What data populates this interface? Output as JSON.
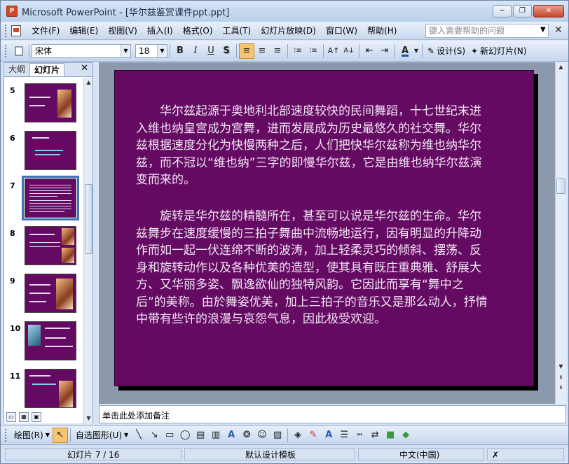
{
  "titlebar": {
    "icon_label": "P",
    "title": "Microsoft PowerPoint - [华尔兹鉴赏课件ppt.ppt]",
    "minimize": "─",
    "restore": "❐",
    "close": "✕"
  },
  "menubar": {
    "items": [
      "文件(F)",
      "编辑(E)",
      "视图(V)",
      "插入(I)",
      "格式(O)",
      "工具(T)",
      "幻灯片放映(D)",
      "窗口(W)",
      "帮助(H)"
    ],
    "help_placeholder": "键入需要帮助的问题",
    "help_arrow": "▼",
    "close": "✕"
  },
  "toolbar": {
    "font_name": "宋体",
    "font_size": "18",
    "bold": "B",
    "italic": "I",
    "underline": "U",
    "shadow": "S",
    "align_left": "≡",
    "align_center": "≡",
    "align_right": "≡",
    "numbering": "⁝≡",
    "bullets": "⁝≡",
    "grow_font": "A↑",
    "shrink_font": "A↓",
    "decrease_indent": "⇤",
    "increase_indent": "⇥",
    "font_color": "A",
    "design_label": "设计(S)",
    "new_slide_label": "新幻灯片(N)"
  },
  "leftpane": {
    "tab_outline": "大纲",
    "tab_slides": "幻灯片",
    "close": "✕",
    "thumbnails": [
      {
        "num": "5"
      },
      {
        "num": "6"
      },
      {
        "num": "7"
      },
      {
        "num": "8"
      },
      {
        "num": "9"
      },
      {
        "num": "10"
      },
      {
        "num": "11"
      }
    ],
    "selected": "7"
  },
  "slide": {
    "paragraph1": "　　华尔兹起源于奥地利北部速度较快的民间舞蹈，十七世纪末进入维也纳皇宫成为宫舞，进而发展成为历史最悠久的社交舞。华尔兹根据速度分化为快慢两种之后，人们把快华尔兹称为维也纳华尔兹，而不冠以“维也纳”三字的即慢华尔兹，它是由维也纳华尔兹演变而来的。",
    "paragraph2": "　　旋转是华尔兹的精髓所在，甚至可以说是华尔兹的生命。华尔兹舞步在速度缓慢的三拍子舞曲中流畅地运行，因有明显的升降动作而如一起一伏连绵不断的波涛，加上轻柔灵巧的倾斜、摆荡、反身和旋转动作以及各种优美的造型，使其具有既庄重典雅、舒展大方、又华丽多姿、飘逸欲仙的独特风韵。它因此而享有“舞中之后”的美称。由於舞姿优美，加上三拍子的音乐又是那么动人，抒情中带有些许的浪漫与哀怨气息，因此极受欢迎。",
    "background_color": "#650a63"
  },
  "notes": {
    "placeholder": "单击此处添加备注"
  },
  "drawbar": {
    "draw_label": "绘图(R)",
    "autoshapes_label": "自选图形(U)"
  },
  "statusbar": {
    "slide_info": "幻灯片 7 / 16",
    "template": "默认设计模板",
    "language": "中文(中国)"
  }
}
